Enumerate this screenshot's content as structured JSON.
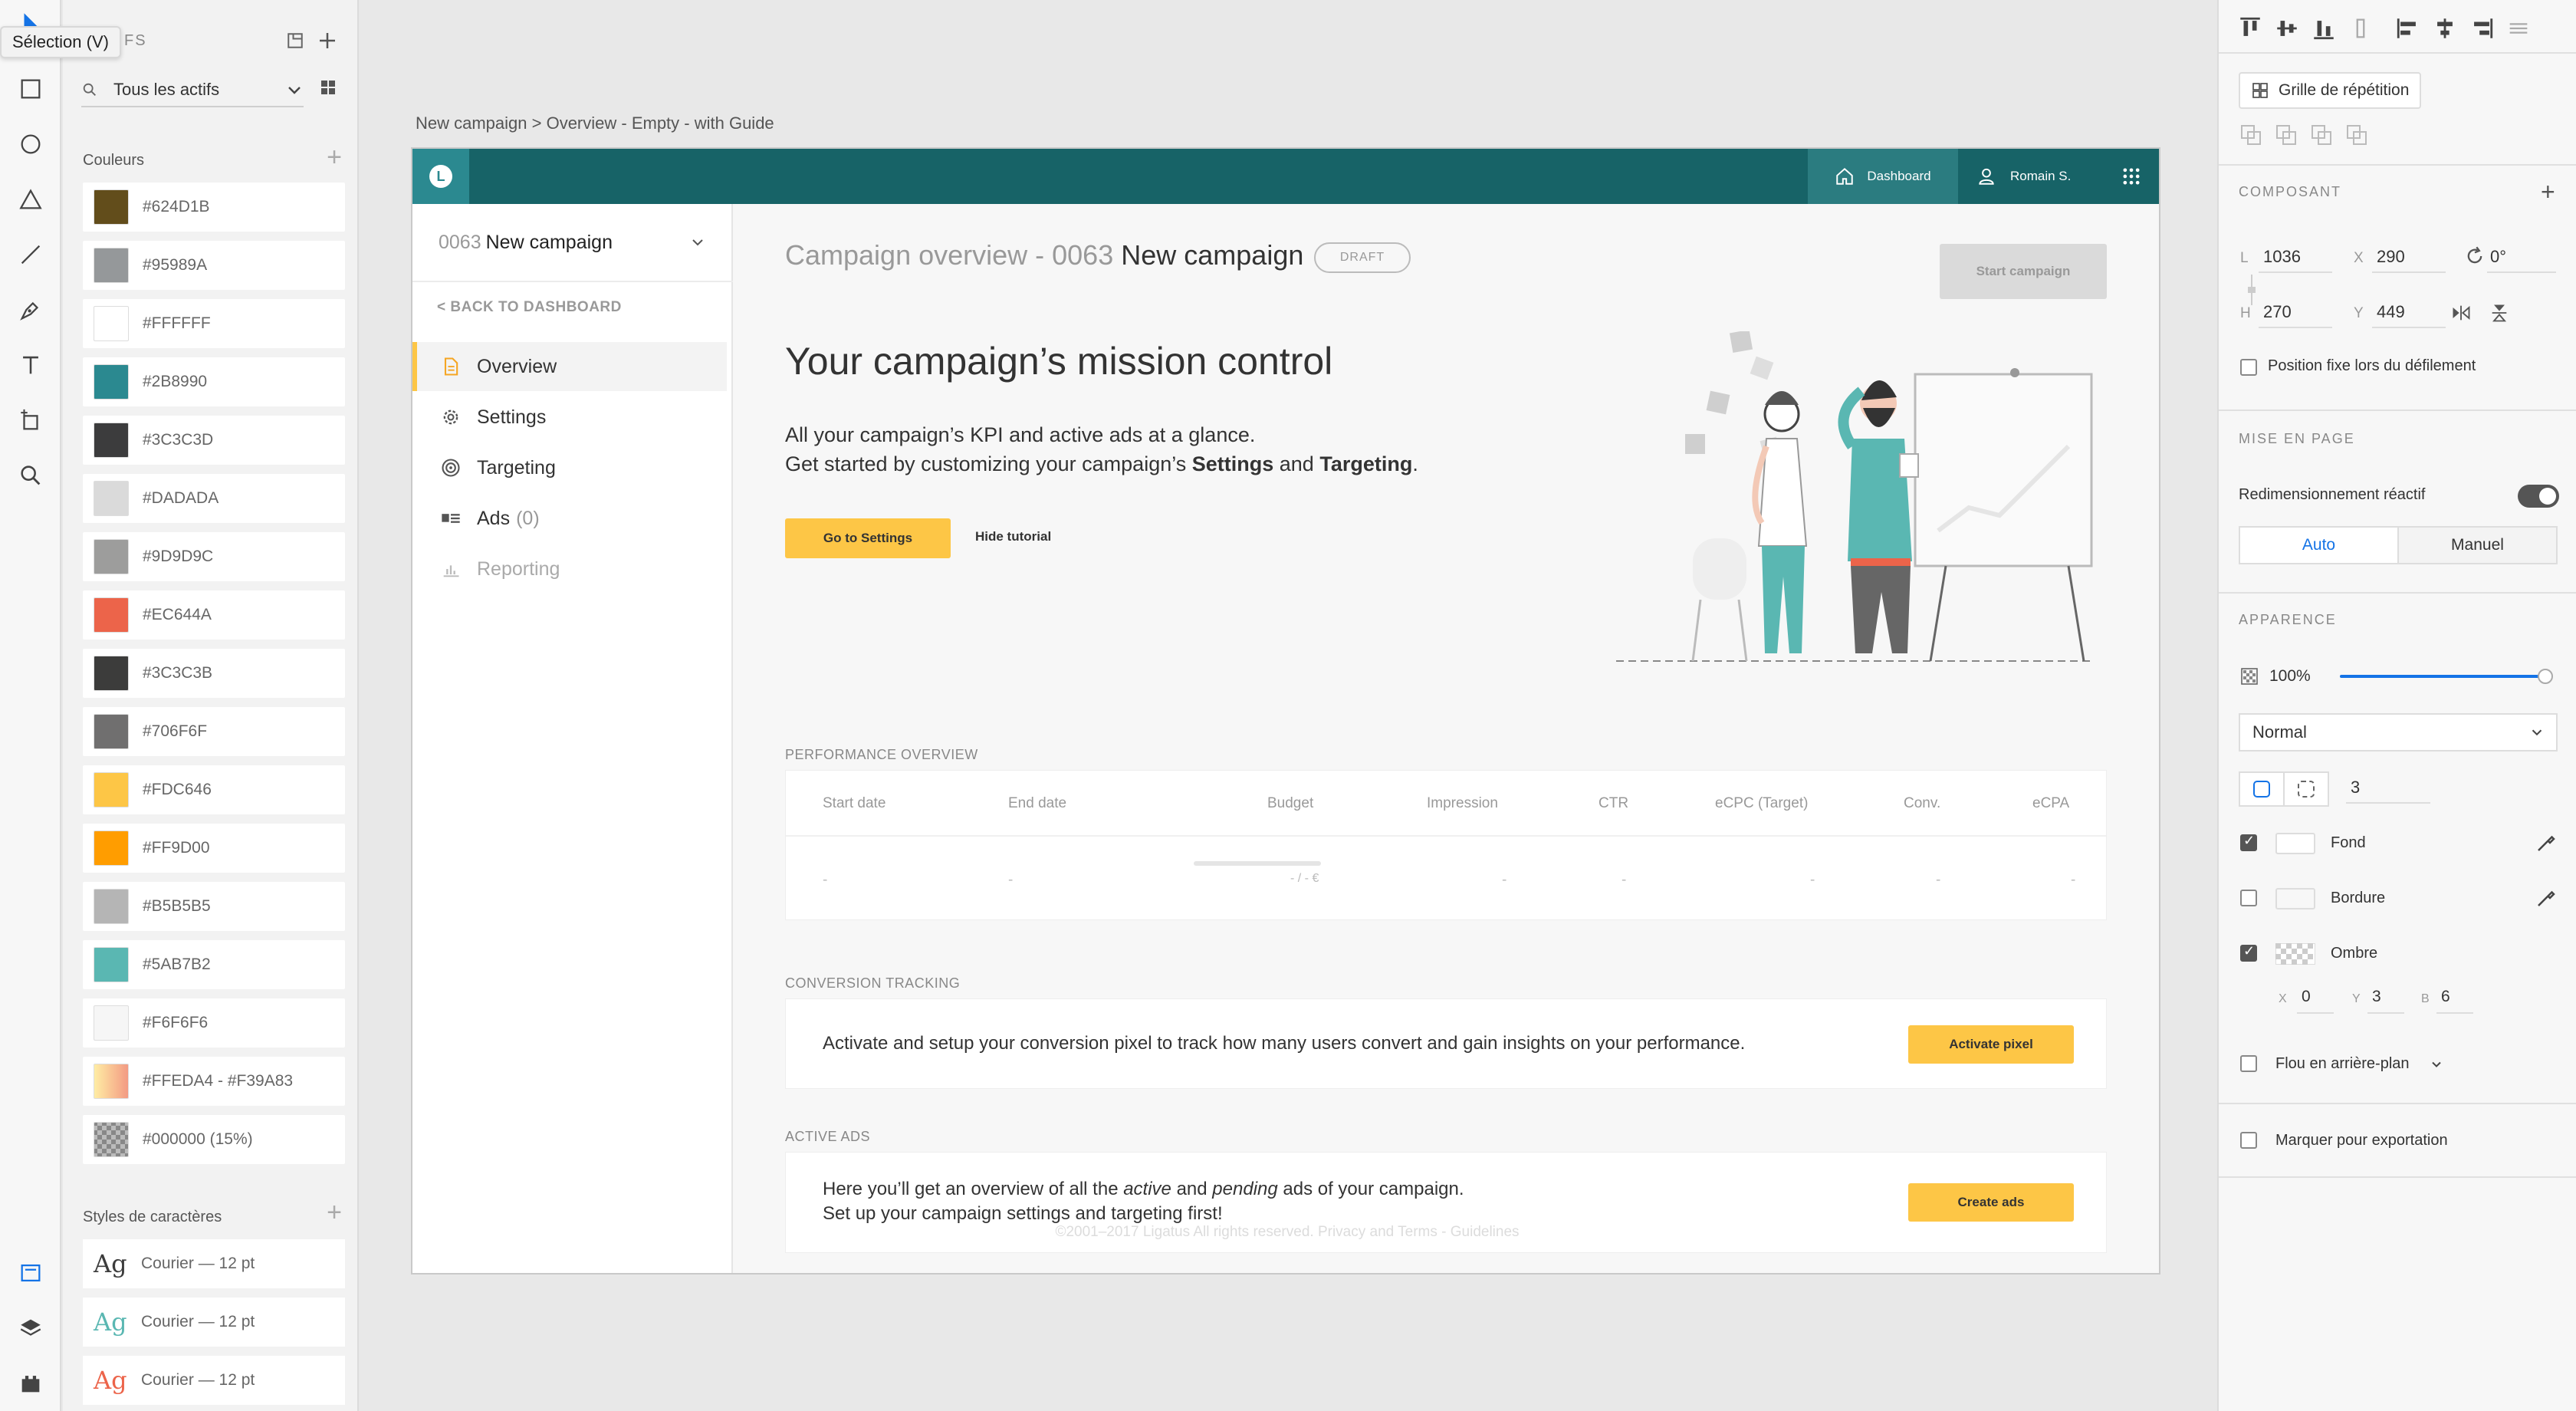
{
  "tooltip": "Sélection (V)",
  "assets": {
    "header_title": "FS",
    "filter_label": "Tous les actifs",
    "colors_title": "Couleurs",
    "colors": [
      {
        "hex": "#624D1B",
        "label": "#624D1B"
      },
      {
        "hex": "#95989A",
        "label": "#95989A"
      },
      {
        "hex": "#FFFFFF",
        "label": "#FFFFFF"
      },
      {
        "hex": "#2B8990",
        "label": "#2B8990"
      },
      {
        "hex": "#3C3C3D",
        "label": "#3C3C3D"
      },
      {
        "hex": "#DADADA",
        "label": "#DADADA"
      },
      {
        "hex": "#9D9D9C",
        "label": "#9D9D9C"
      },
      {
        "hex": "#EC644A",
        "label": "#EC644A"
      },
      {
        "hex": "#3C3C3B",
        "label": "#3C3C3B"
      },
      {
        "hex": "#706F6F",
        "label": "#706F6F"
      },
      {
        "hex": "#FDC646",
        "label": "#FDC646"
      },
      {
        "hex": "#FF9D00",
        "label": "#FF9D00"
      },
      {
        "hex": "#B5B5B5",
        "label": "#B5B5B5"
      },
      {
        "hex": "#5AB7B2",
        "label": "#5AB7B2"
      },
      {
        "hex": "#F6F6F6",
        "label": "#F6F6F6"
      },
      {
        "hex": "gradient",
        "label": "#FFEDA4 - #F39A83"
      },
      {
        "hex": "checker",
        "label": "#000000 (15%)"
      }
    ],
    "char_styles_title": "Styles de caractères",
    "char_styles": [
      {
        "glyph": "Ag",
        "color": "#3c3c3c",
        "label": "Courier — 12 pt"
      },
      {
        "glyph": "Ag",
        "color": "#5ab7b2",
        "label": "Courier — 12 pt"
      },
      {
        "glyph": "Ag",
        "color": "#ec644a",
        "label": "Courier — 12 pt"
      }
    ]
  },
  "canvas": {
    "breadcrumb": "New campaign > Overview - Empty - with Guide"
  },
  "app": {
    "logo_letter": "L",
    "nav_dashboard": "Dashboard",
    "nav_user": "Romain S.",
    "campaign_number": "0063",
    "campaign_name": "New campaign",
    "back_link": "< BACK TO DASHBOARD",
    "menu": [
      {
        "label": "Overview",
        "icon": "document-icon"
      },
      {
        "label": "Settings",
        "icon": "gear-icon"
      },
      {
        "label": "Targeting",
        "icon": "target-icon"
      },
      {
        "label": "Ads",
        "count": "(0)",
        "icon": "ads-icon"
      },
      {
        "label": "Reporting",
        "icon": "chart-icon"
      }
    ],
    "title_prefix": "Campaign overview - 0063",
    "title_name": "New campaign",
    "draft_badge": "DRAFT",
    "start_button": "Start campaign",
    "mission_title": "Your campaign’s mission control",
    "mission_line1": "All your campaign’s KPI and active ads at a glance.",
    "mission_line2_a": "Get started by customizing your campaign’s ",
    "mission_line2_settings": "Settings",
    "mission_line2_and": " and ",
    "mission_line2_targeting": "Targeting",
    "mission_line2_end": ".",
    "go_settings": "Go to Settings",
    "hide_tutorial": "Hide tutorial",
    "performance_title": "PERFORMANCE OVERVIEW",
    "performance_columns": [
      "Start date",
      "End date",
      "Budget",
      "Impression",
      "CTR",
      "eCPC (Target)",
      "Conv.",
      "eCPA"
    ],
    "performance_values": [
      "-",
      "-",
      "- / - €",
      "-",
      "-",
      "-",
      "-",
      "-"
    ],
    "conversion_title": "CONVERSION TRACKING",
    "conversion_text": "Activate and setup your conversion pixel to track how many users convert and gain insights on your performance.",
    "activate_pixel": "Activate pixel",
    "active_ads_title": "ACTIVE ADS",
    "ads_text_1a": "Here you’ll get an overview of all the ",
    "ads_text_active": "active",
    "ads_text_1b": " and ",
    "ads_text_pending": "pending",
    "ads_text_1c": " ads of your campaign.",
    "ads_text_2": "Set up your campaign settings and targeting first!",
    "create_ads": "Create ads",
    "footer": "©2001–2017 Ligatus All rights reserved. Privacy and Terms - Guidelines"
  },
  "inspector": {
    "repeat_grid": "Grille de répétition",
    "component_title": "COMPOSANT",
    "w_label": "L",
    "w_value": "1036",
    "x_label": "X",
    "x_value": "290",
    "rotation": "0°",
    "h_label": "H",
    "h_value": "270",
    "y_label": "Y",
    "y_value": "449",
    "fixed_position": "Position fixe lors du défilement",
    "layout_title": "MISE EN PAGE",
    "responsive_resize": "Redimensionnement réactif",
    "seg_auto": "Auto",
    "seg_manual": "Manuel",
    "appearance_title": "APPARENCE",
    "opacity": "100%",
    "opacity_level": 1.0,
    "blend_mode": "Normal",
    "corner_radius": "3",
    "fill_label": "Fond",
    "border_label": "Bordure",
    "shadow_label": "Ombre",
    "shadow_x_label": "X",
    "shadow_x": "0",
    "shadow_y_label": "Y",
    "shadow_y": "3",
    "shadow_b_label": "B",
    "shadow_b": "6",
    "bg_blur": "Flou en arrière-plan",
    "export_mark": "Marquer pour exportation"
  }
}
